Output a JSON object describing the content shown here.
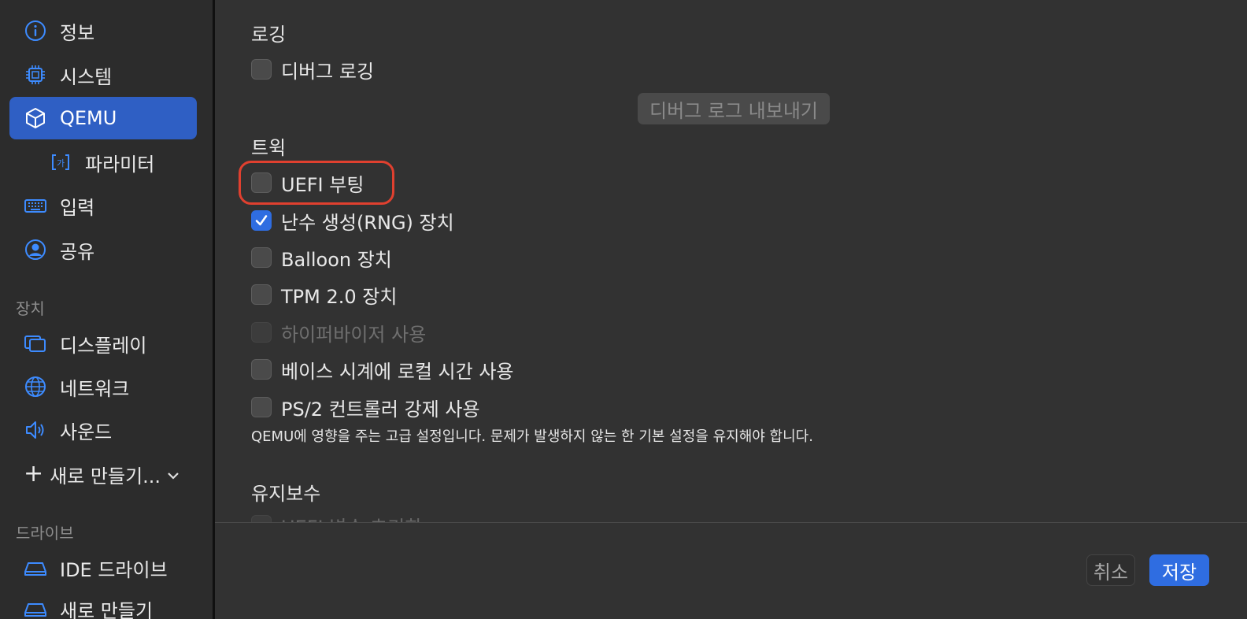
{
  "sidebar": {
    "items": [
      {
        "label": "정보",
        "icon": "info-icon"
      },
      {
        "label": "시스템",
        "icon": "cpu-icon"
      },
      {
        "label": "QEMU",
        "icon": "cube-icon"
      },
      {
        "label": "파라미터",
        "icon": "parameter-icon"
      },
      {
        "label": "입력",
        "icon": "keyboard-icon"
      },
      {
        "label": "공유",
        "icon": "person-circle-icon"
      }
    ],
    "devices_label": "장치",
    "device_items": [
      {
        "label": "디스플레이",
        "icon": "display-icon"
      },
      {
        "label": "네트워크",
        "icon": "globe-icon"
      },
      {
        "label": "사운드",
        "icon": "speaker-icon"
      }
    ],
    "new_label": "새로 만들기...",
    "drives_label": "드라이브",
    "drive_items": [
      {
        "label": "IDE 드라이브",
        "icon": "drive-icon"
      },
      {
        "label": "새로 만들기",
        "icon": "drive-icon"
      }
    ],
    "selected": "QEMU",
    "accent_color": "#2f5fc4"
  },
  "main": {
    "logging": {
      "heading": "로깅",
      "debug_logging": {
        "label": "디버그 로깅",
        "checked": false
      },
      "export_button": "디버그 로그 내보내기"
    },
    "tweaks": {
      "heading": "트윅",
      "options": [
        {
          "label": "UEFI 부팅",
          "checked": false,
          "disabled": false
        },
        {
          "label": "난수 생성(RNG) 장치",
          "checked": true,
          "disabled": false
        },
        {
          "label": "Balloon 장치",
          "checked": false,
          "disabled": false
        },
        {
          "label": "TPM 2.0 장치",
          "checked": false,
          "disabled": false
        },
        {
          "label": "하이퍼바이저 사용",
          "checked": false,
          "disabled": true
        },
        {
          "label": "베이스 시계에 로컬 시간 사용",
          "checked": false,
          "disabled": false
        },
        {
          "label": "PS/2 컨트롤러 강제 사용",
          "checked": false,
          "disabled": false
        }
      ],
      "description": "QEMU에 영향을 주는 고급 설정입니다. 문제가 발생하지 않는 한 기본 설정을 유지해야 합니다."
    },
    "maintenance": {
      "heading": "유지보수",
      "partial_item": "UEFI 변수 초기화"
    }
  },
  "footer": {
    "cancel": "취소",
    "save": "저장"
  },
  "colors": {
    "checkbox_checked": "#2f6de1",
    "highlight": "#e0402f"
  }
}
